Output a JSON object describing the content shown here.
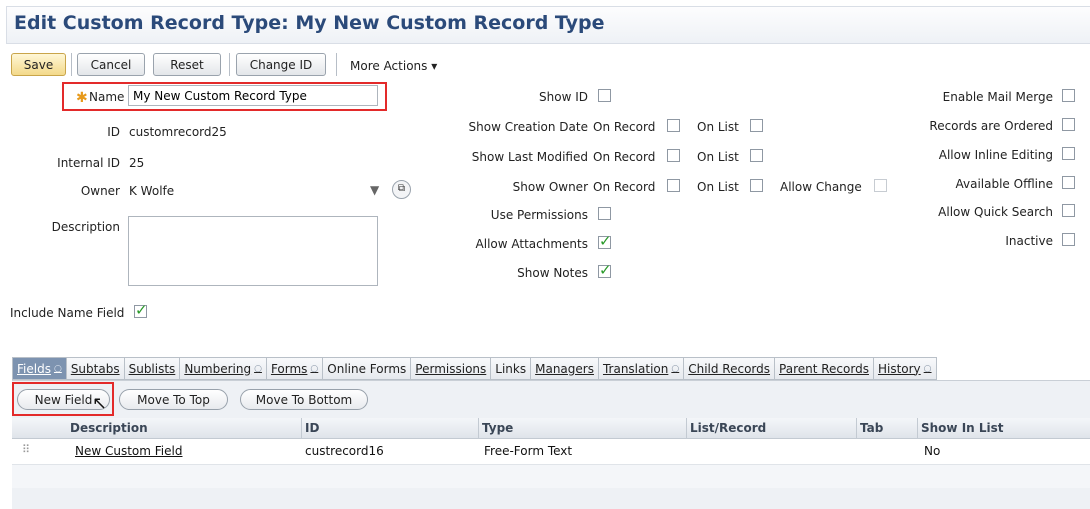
{
  "page": {
    "title": "Edit Custom Record Type: My New Custom Record Type"
  },
  "toolbar": {
    "save": "Save",
    "cancel": "Cancel",
    "reset": "Reset",
    "change_id": "Change ID",
    "more_actions": "More Actions ▾"
  },
  "form": {
    "name_label": "Name",
    "name_value": "My New Custom Record Type",
    "id_label": "ID",
    "id_value": "customrecord25",
    "internal_id_label": "Internal ID",
    "internal_id_value": "25",
    "owner_label": "Owner",
    "owner_value": "K Wolfe",
    "description_label": "Description",
    "description_value": "",
    "include_name_label": "Include Name Field",
    "include_name_checked": true
  },
  "middle": {
    "show_id": "Show ID",
    "show_creation_date": "Show Creation Date",
    "show_last_modified": "Show Last Modified",
    "show_owner": "Show Owner",
    "use_permissions": "Use Permissions",
    "allow_attachments": "Allow Attachments",
    "show_notes": "Show Notes",
    "on_record": "On Record",
    "on_list": "On List",
    "allow_change": "Allow Change"
  },
  "right": {
    "enable_mail_merge": "Enable Mail Merge",
    "records_ordered": "Records are Ordered",
    "allow_inline_editing": "Allow Inline Editing",
    "available_offline": "Available Offline",
    "allow_quick_search": "Allow Quick Search",
    "inactive": "Inactive"
  },
  "tabs": {
    "fields": "Fields",
    "subtabs": "Subtabs",
    "sublists": "Sublists",
    "numbering": "Numbering",
    "forms": "Forms",
    "online_forms": "Online Forms",
    "permissions": "Permissions",
    "links": "Links",
    "managers": "Managers",
    "translation": "Translation",
    "child_records": "Child Records",
    "parent_records": "Parent Records",
    "history": "History",
    "dot": "○"
  },
  "subtab_buttons": {
    "new_field": "New Field",
    "move_to_top": "Move To Top",
    "move_to_bottom": "Move To Bottom"
  },
  "grid": {
    "headers": {
      "description": "Description",
      "id": "ID",
      "type": "Type",
      "list_record": "List/Record",
      "tab": "Tab",
      "show_in_list": "Show In List"
    },
    "row": {
      "description": "New Custom Field",
      "id": "custrecord16",
      "type": "Free-Form Text",
      "list_record": "",
      "tab": "",
      "show_in_list": "No"
    }
  },
  "colors": {
    "title": "#2b4a7a",
    "highlight": "#e32a2a",
    "check": "#2a9a2a",
    "active_tab": "#7d93b0"
  }
}
